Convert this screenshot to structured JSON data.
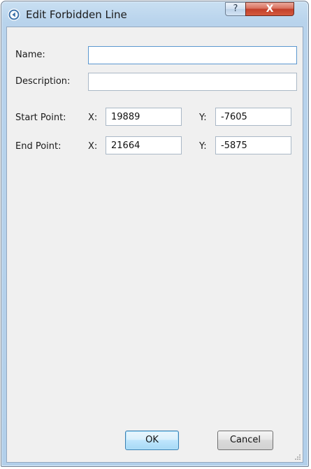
{
  "window": {
    "title": "Edit Forbidden Line",
    "help_glyph": "?",
    "close_glyph": "X"
  },
  "form": {
    "name_label": "Name:",
    "name_value": "",
    "description_label": "Description:",
    "description_value": "",
    "start_label": "Start Point:",
    "start_x_label": "X:",
    "start_x_value": "19889",
    "start_y_label": "Y:",
    "start_y_value": "-7605",
    "end_label": "End Point:",
    "end_x_label": "X:",
    "end_x_value": "21664",
    "end_y_label": "Y:",
    "end_y_value": "-5875"
  },
  "buttons": {
    "ok_label": "OK",
    "cancel_label": "Cancel"
  },
  "icons": {
    "title": "navigation-arrow-icon",
    "help": "help-icon",
    "close": "close-icon",
    "resize": "resize-grip-icon"
  },
  "colors": {
    "titlebar": "#b8d3ec",
    "client_bg": "#f0f0f0",
    "close_button": "#c2402b",
    "focus_border": "#5b97cf"
  }
}
